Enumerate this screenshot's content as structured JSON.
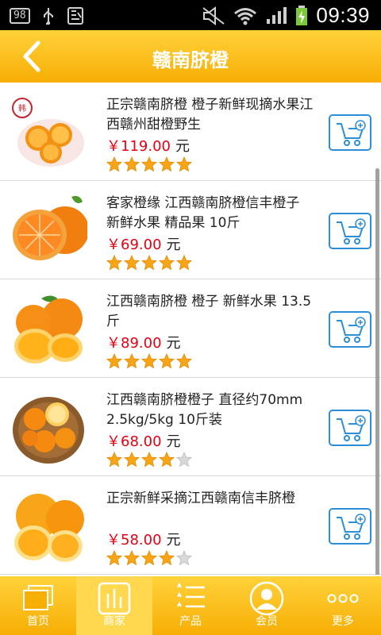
{
  "status_bar": {
    "badge": "98",
    "time": "09:39"
  },
  "header": {
    "title": "赣南脐橙"
  },
  "colors": {
    "accent": "#f7ae05",
    "price": "#e60012",
    "cart": "#2b8ed6"
  },
  "products": [
    {
      "name": "正宗赣南脐橙 橙子新鲜现摘水果江西赣州甜橙野生",
      "price": "￥119.00",
      "unit": "元",
      "rating": 5
    },
    {
      "name": "客家橙缘 江西赣南脐橙信丰橙子 新鲜水果 精品果 10斤",
      "price": "￥69.00",
      "unit": "元",
      "rating": 5
    },
    {
      "name": "江西赣南脐橙 橙子 新鲜水果 13.5斤",
      "price": "￥89.00",
      "unit": "元",
      "rating": 5
    },
    {
      "name": "江西赣南脐橙橙子 直径约70mm 2.5kg/5kg 10斤装",
      "price": "￥68.00",
      "unit": "元",
      "rating": 4
    },
    {
      "name": "正宗新鲜采摘江西赣南信丰脐橙",
      "price": "￥58.00",
      "unit": "元",
      "rating": 4
    }
  ],
  "nav": {
    "items": [
      {
        "label": "首页",
        "icon": "home-icon"
      },
      {
        "label": "商家",
        "icon": "merchant-icon"
      },
      {
        "label": "产品",
        "icon": "product-list-icon"
      },
      {
        "label": "会员",
        "icon": "member-icon"
      },
      {
        "label": "更多",
        "icon": "more-icon"
      }
    ]
  }
}
